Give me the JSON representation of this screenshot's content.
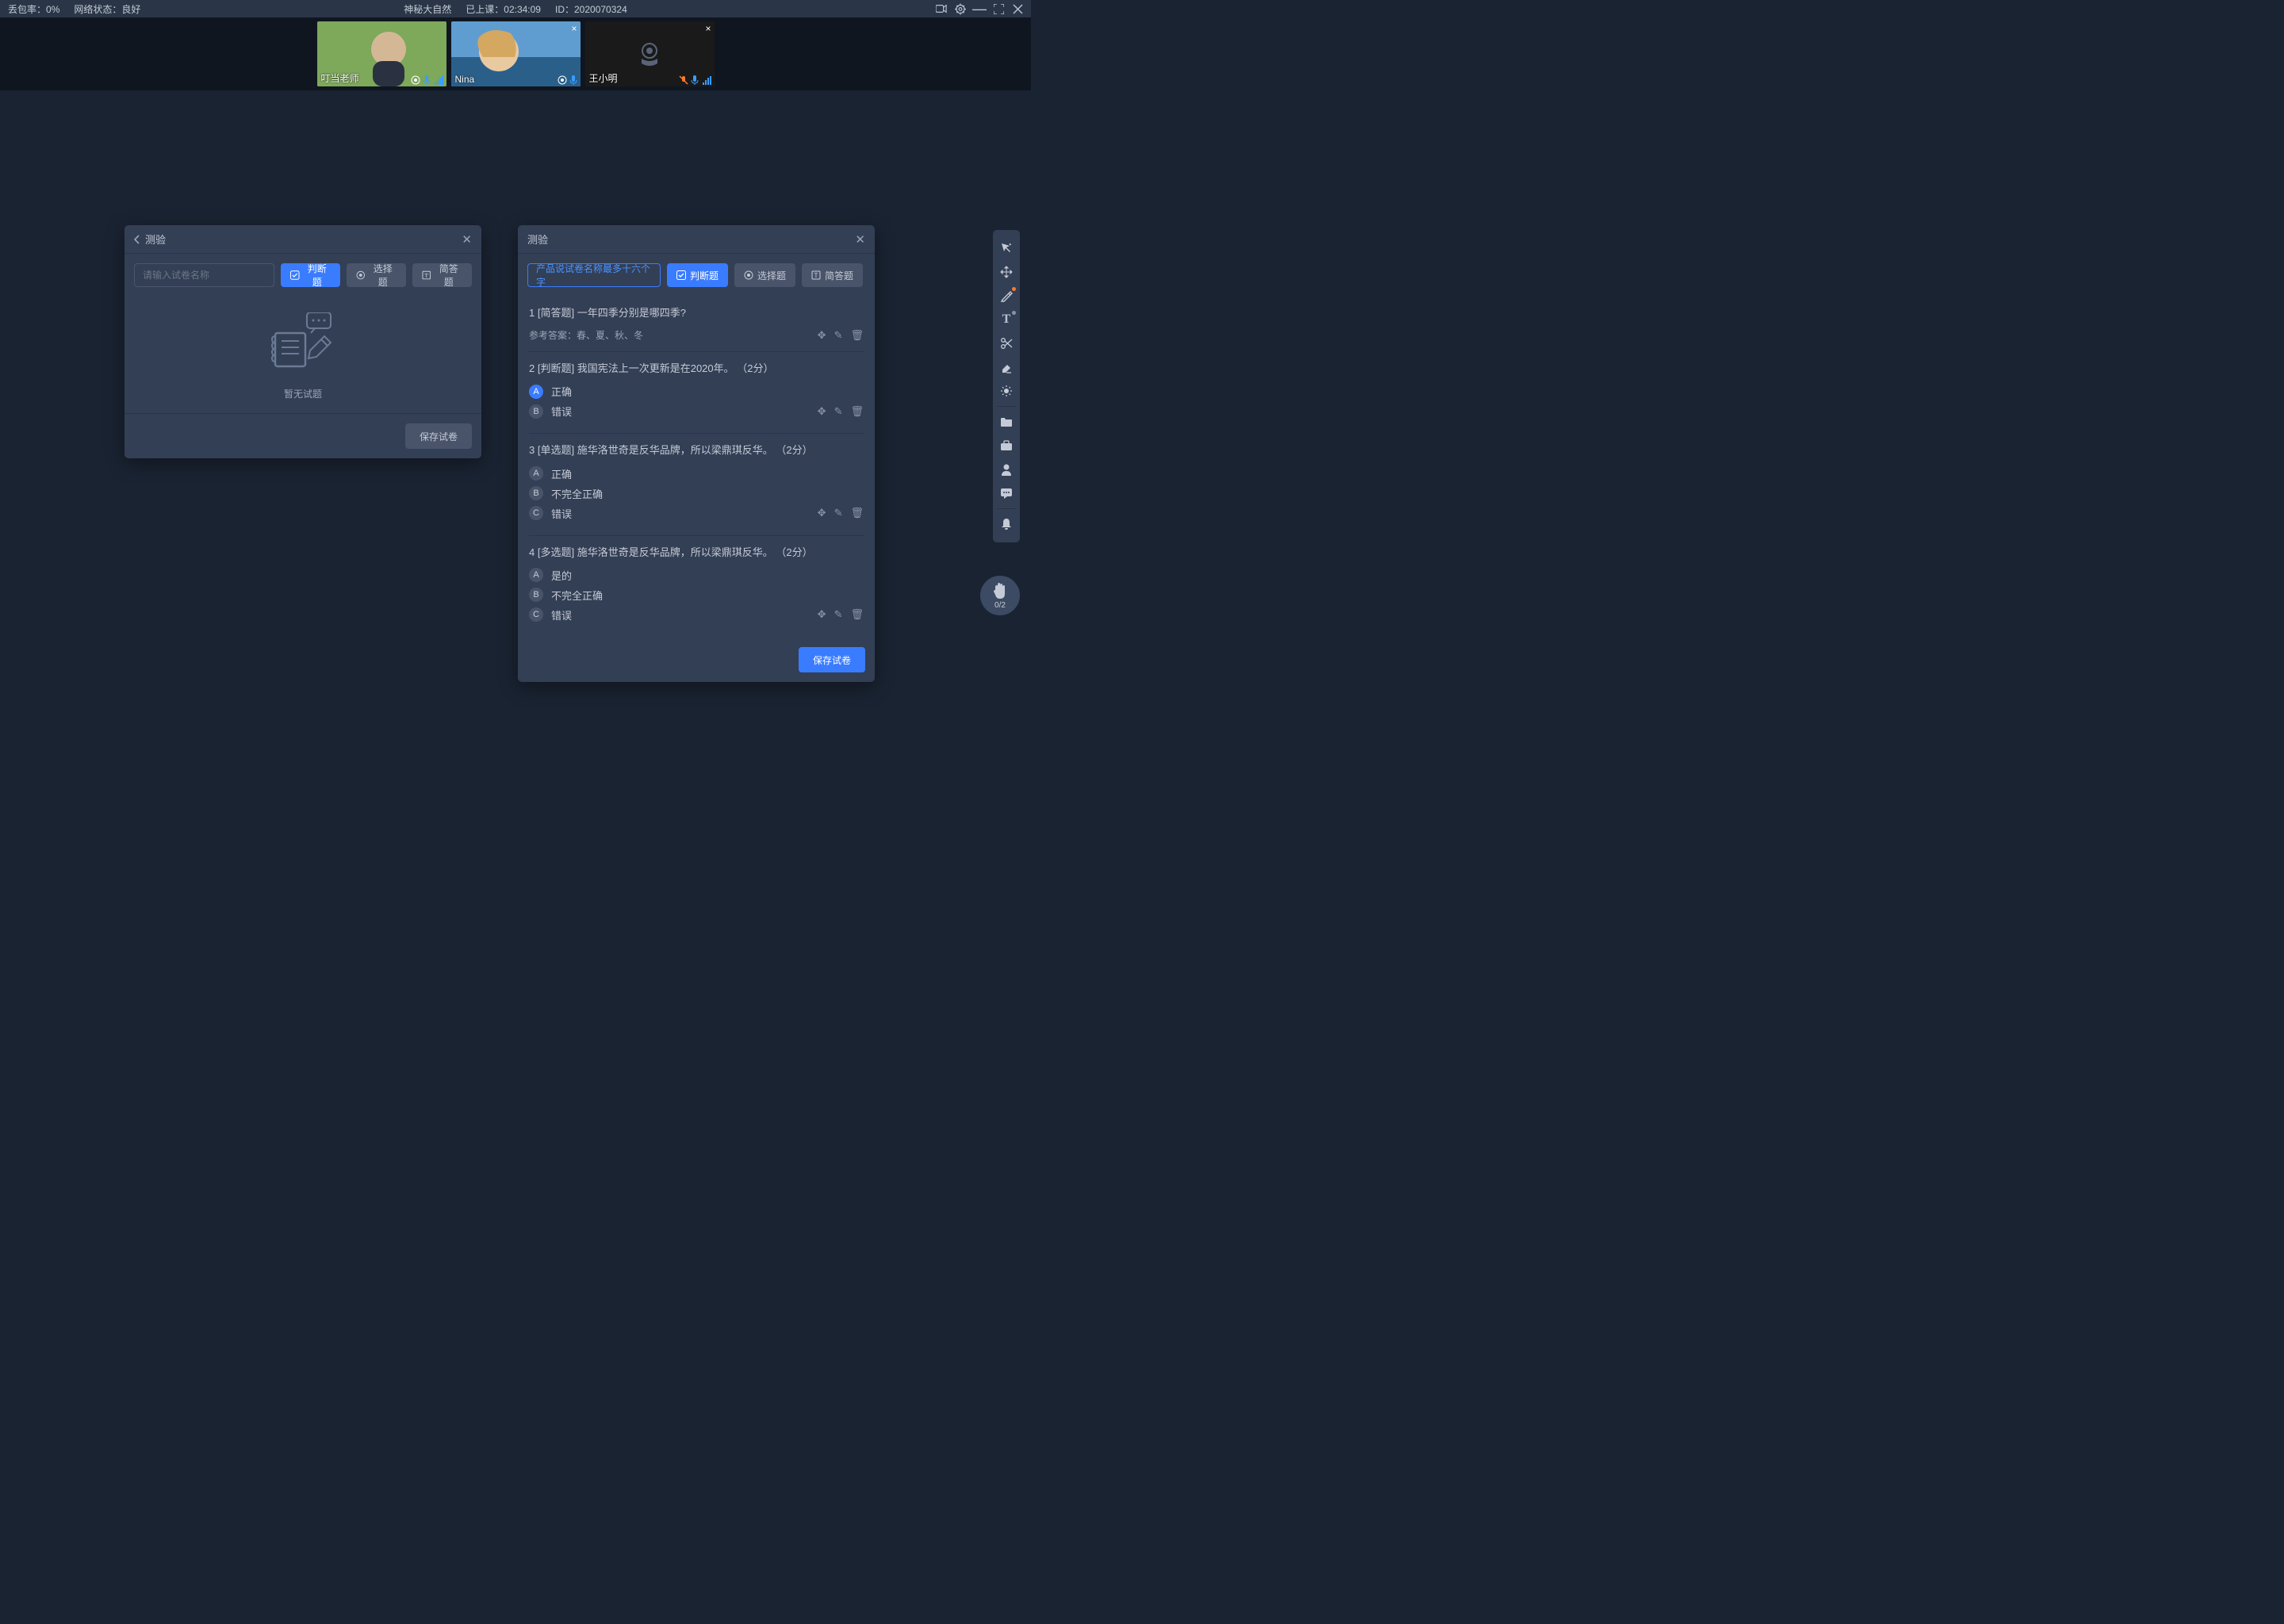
{
  "topbar": {
    "packet_loss_label": "丢包率：",
    "packet_loss_value": "0%",
    "network_label": "网络状态：",
    "network_value": "良好",
    "course_title": "神秘大自然",
    "elapsed_label": "已上课：",
    "elapsed_value": "02:34:09",
    "id_label": "ID：",
    "id_value": "2020070324"
  },
  "videos": [
    {
      "name": "叮当老师",
      "has_close": false,
      "camera_off": false
    },
    {
      "name": "Nina",
      "has_close": true,
      "camera_off": false
    },
    {
      "name": "王小明",
      "has_close": true,
      "camera_off": true
    }
  ],
  "panel_left": {
    "title": "测验",
    "placeholder": "请输入试卷名称",
    "btn_judge": "判断题",
    "btn_choice": "选择题",
    "btn_short": "简答题",
    "empty_text": "暂无试题",
    "save": "保存试卷"
  },
  "panel_right": {
    "title": "测验",
    "name_value": "产品说试卷名称最多十六个字",
    "btn_judge": "判断题",
    "btn_choice": "选择题",
    "btn_short": "简答题",
    "save": "保存试卷",
    "answer_prefix": "参考答案：",
    "questions": [
      {
        "num": "1",
        "tag": "[简答题]",
        "text": "一年四季分别是哪四季?",
        "answer": "春、夏、秋、冬",
        "type": "short"
      },
      {
        "num": "2",
        "tag": "[判断题]",
        "text": "我国宪法上一次更新是在2020年。",
        "score": "（2分）",
        "type": "judge",
        "options": [
          {
            "letter": "A",
            "text": "正确",
            "on": true
          },
          {
            "letter": "B",
            "text": "错误",
            "on": false
          }
        ]
      },
      {
        "num": "3",
        "tag": "[单选题]",
        "text": "施华洛世奇是反华品牌，所以梁鼎琪反华。",
        "score": "（2分）",
        "type": "single",
        "options": [
          {
            "letter": "A",
            "text": "正确",
            "on": false
          },
          {
            "letter": "B",
            "text": "不完全正确",
            "on": false
          },
          {
            "letter": "C",
            "text": "错误",
            "on": false
          }
        ]
      },
      {
        "num": "4",
        "tag": "[多选题]",
        "text": "施华洛世奇是反华品牌，所以梁鼎琪反华。",
        "score": "（2分）",
        "type": "multi",
        "options": [
          {
            "letter": "A",
            "text": "是的",
            "on": false
          },
          {
            "letter": "B",
            "text": "不完全正确",
            "on": false
          },
          {
            "letter": "C",
            "text": "错误",
            "on": false
          }
        ]
      }
    ]
  },
  "sidebar_tools": [
    "cursor-star",
    "move",
    "pen",
    "text",
    "scissors",
    "eraser",
    "brightness",
    "SEP",
    "folder",
    "briefcase",
    "user",
    "chat",
    "SEP",
    "bell"
  ],
  "hand_raise": {
    "count": "0/2"
  }
}
